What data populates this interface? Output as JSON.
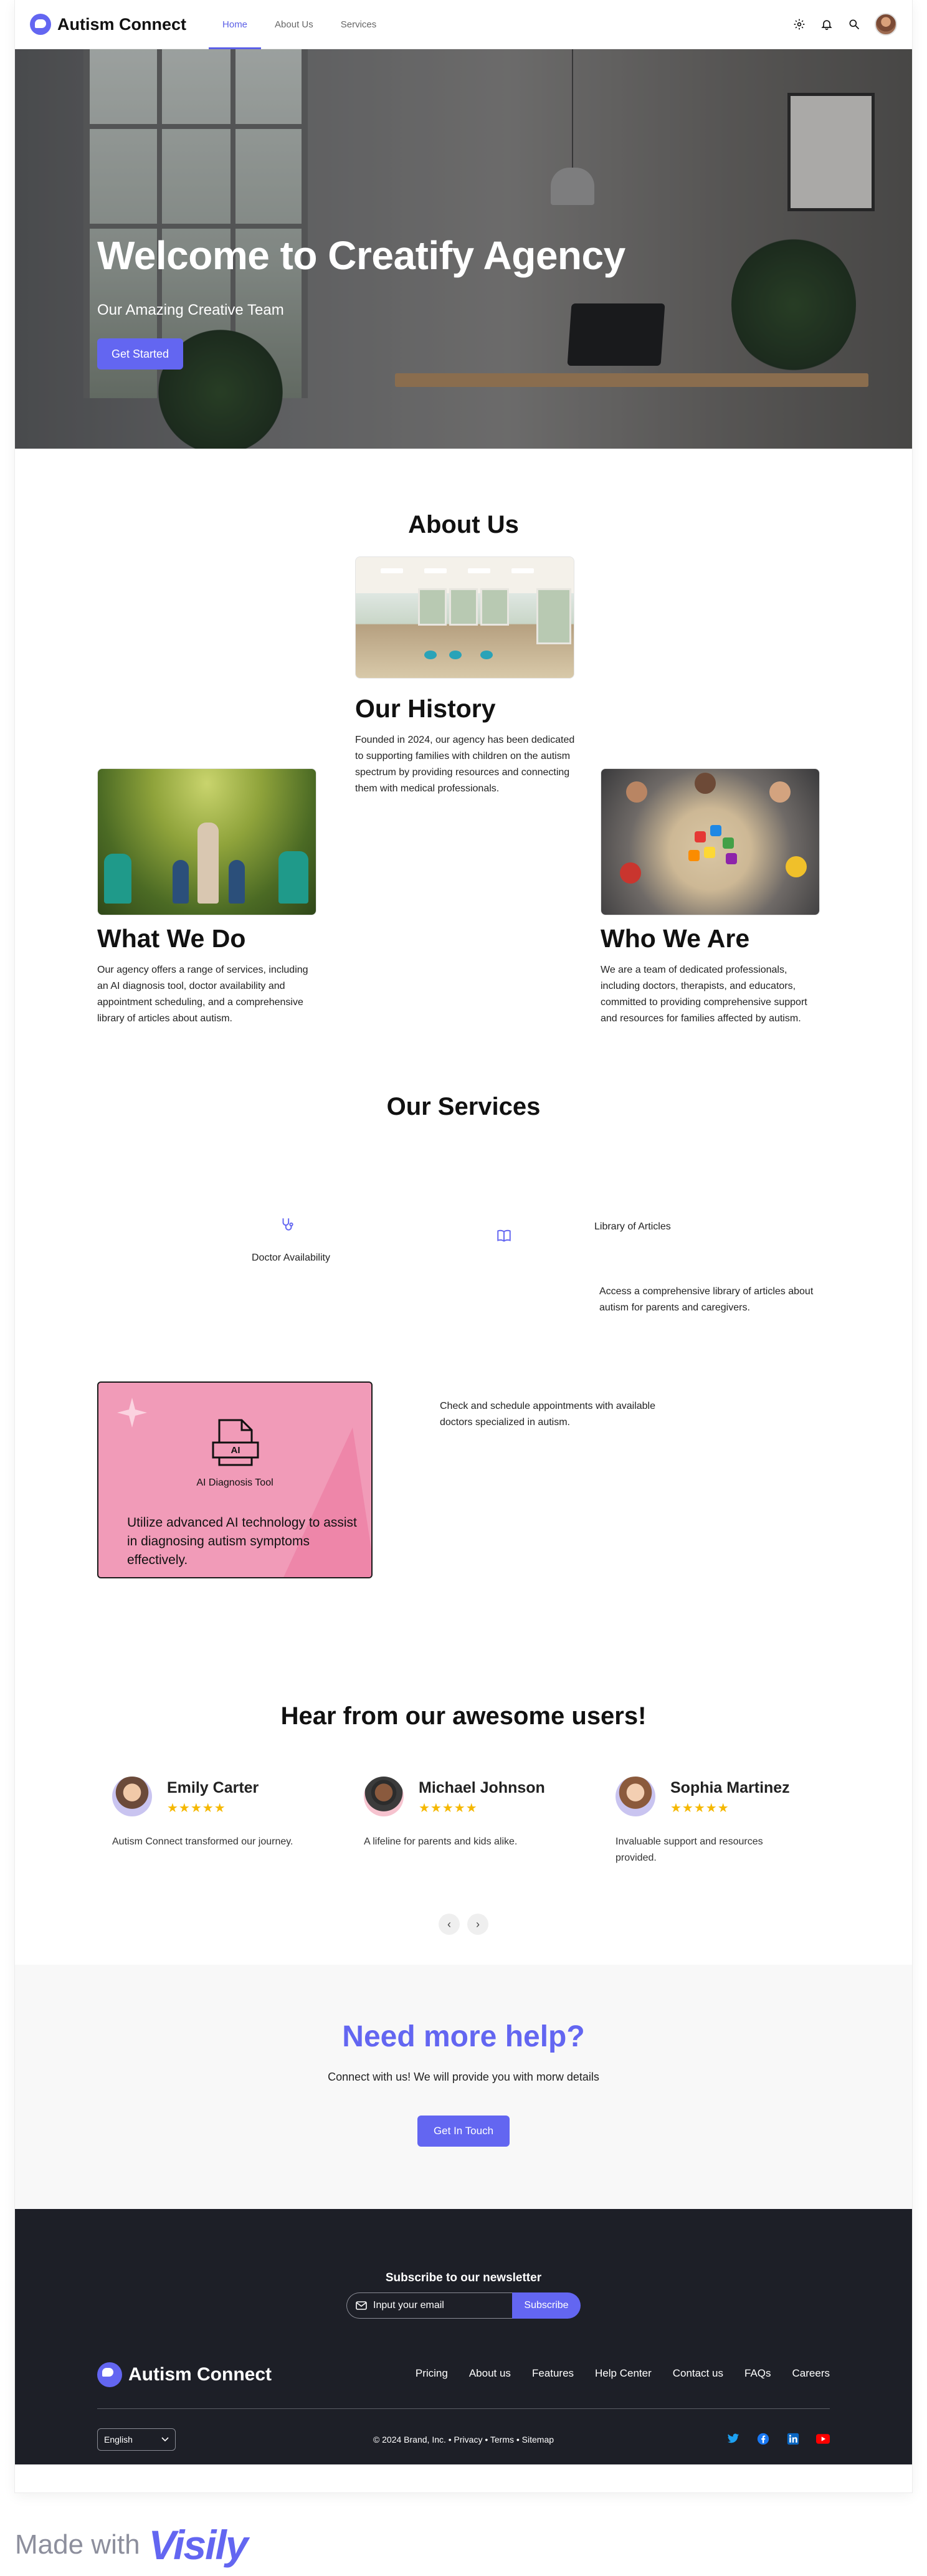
{
  "nav": {
    "brand": "Autism Connect",
    "links": [
      {
        "label": "Home",
        "active": true
      },
      {
        "label": "About Us",
        "active": false
      },
      {
        "label": "Services",
        "active": false
      }
    ],
    "icons": [
      "gear-icon",
      "bell-icon",
      "search-icon",
      "avatar"
    ]
  },
  "hero": {
    "title": "Welcome to Creatify Agency",
    "subtitle": "Our Amazing Creative Team",
    "cta": "Get Started"
  },
  "about": {
    "title": "About Us",
    "history": {
      "title": "Our History",
      "text": "Founded in 2024, our agency has been dedicated to supporting families with children on the autism spectrum by providing resources and connecting them with medical professionals."
    },
    "what": {
      "title": "What We Do",
      "text": "Our agency offers a range of services, including an AI diagnosis tool, doctor availability and appointment scheduling, and a comprehensive library of articles about autism."
    },
    "who": {
      "title": "Who We Are",
      "text": "We are a team of dedicated professionals, including doctors, therapists, and educators, committed to providing comprehensive support and resources for families affected by autism."
    }
  },
  "services": {
    "title": "Our Services",
    "doctor": {
      "label": "Doctor Availability",
      "desc": "Check and schedule appointments with available doctors specialized in autism."
    },
    "library": {
      "label": "Library of Articles",
      "desc": "Access a comprehensive library of articles about autism for parents and caregivers."
    },
    "ai": {
      "icon_text": "AI",
      "label": "AI Diagnosis Tool",
      "desc": "Utilize advanced AI technology to assist in diagnosing autism symptoms effectively."
    }
  },
  "testimonials": {
    "title": "Hear from our awesome users!",
    "items": [
      {
        "name": "Emily Carter",
        "stars": "★★★★★",
        "quote": "Autism Connect transformed our journey."
      },
      {
        "name": "Michael Johnson",
        "stars": "★★★★★",
        "quote": "A lifeline for parents and kids alike."
      },
      {
        "name": "Sophia Martinez",
        "stars": "★★★★★",
        "quote": "Invaluable support and resources provided."
      }
    ],
    "prev": "‹",
    "next": "›"
  },
  "help": {
    "title": "Need more help?",
    "subtitle": "Connect with us! We will provide you with morw details",
    "cta": "Get In Touch"
  },
  "footer": {
    "newsletter_title": "Subscribe to our newsletter",
    "email_placeholder": "Input your email",
    "subscribe": "Subscribe",
    "brand": "Autism Connect",
    "links": [
      "Pricing",
      "About us",
      "Features",
      "Help Center",
      "Contact us",
      "FAQs",
      "Careers"
    ],
    "language": "English",
    "copyright": "© 2024 Brand, Inc. • Privacy • Terms • Sitemap",
    "socials": [
      "twitter-icon",
      "facebook-icon",
      "linkedin-icon",
      "youtube-icon"
    ]
  },
  "made_with": {
    "text": "Made with",
    "logo": "Visily"
  },
  "colors": {
    "accent": "#6366f1",
    "footer_bg": "#1d1f27",
    "ai_card": "#f19bb8",
    "star": "#f5b800"
  }
}
